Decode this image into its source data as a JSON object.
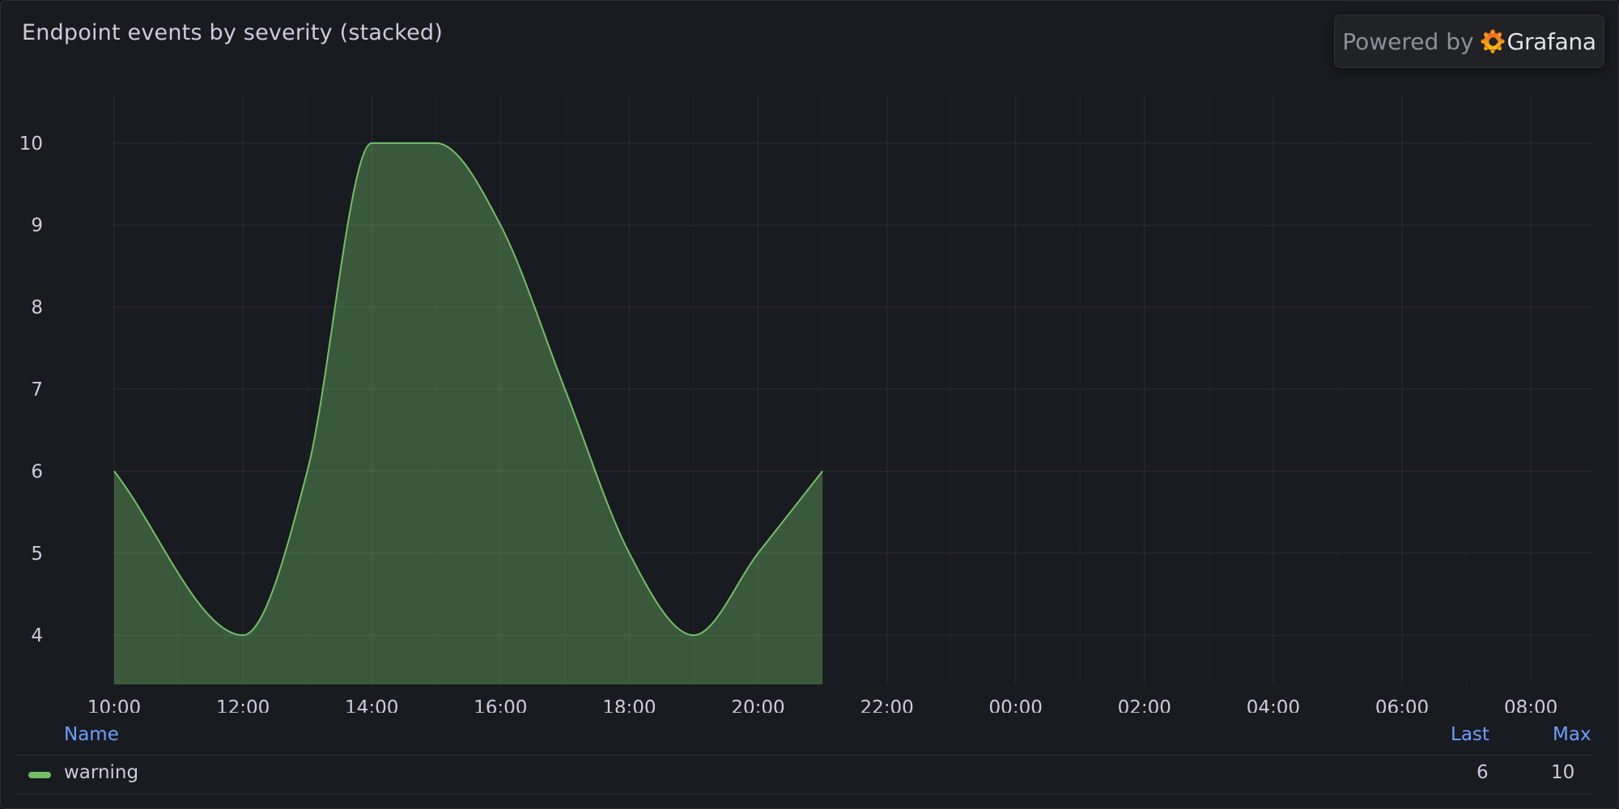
{
  "panel": {
    "title": "Endpoint events by severity (stacked)"
  },
  "branding": {
    "powered_by": "Powered by",
    "brand": "Grafana",
    "logo_icon": "grafana-logo-icon"
  },
  "chart_data": {
    "type": "area",
    "title": "Endpoint events by severity (stacked)",
    "xlabel": "",
    "ylabel": "",
    "x_ticks": [
      "10:00",
      "12:00",
      "14:00",
      "16:00",
      "18:00",
      "20:00",
      "22:00",
      "00:00",
      "02:00",
      "04:00",
      "06:00",
      "08:00"
    ],
    "y_ticks": [
      4,
      5,
      6,
      7,
      8,
      9,
      10
    ],
    "ylim": [
      3.4,
      10.6
    ],
    "x_range_hours": [
      0,
      23.3
    ],
    "grid": true,
    "legend": "bottom",
    "series": [
      {
        "name": "warning",
        "color": "#73bf69",
        "x_hours": [
          0,
          2,
          3,
          4,
          5,
          6,
          7,
          8,
          9,
          10,
          11
        ],
        "values": [
          6,
          4,
          6,
          10,
          10,
          9,
          7,
          5,
          4,
          5,
          6
        ]
      }
    ]
  },
  "legend": {
    "headers": {
      "name": "Name",
      "last": "Last",
      "max": "Max"
    },
    "rows": [
      {
        "name": "warning",
        "last": "6",
        "max": "10",
        "color": "#73bf69"
      }
    ]
  }
}
